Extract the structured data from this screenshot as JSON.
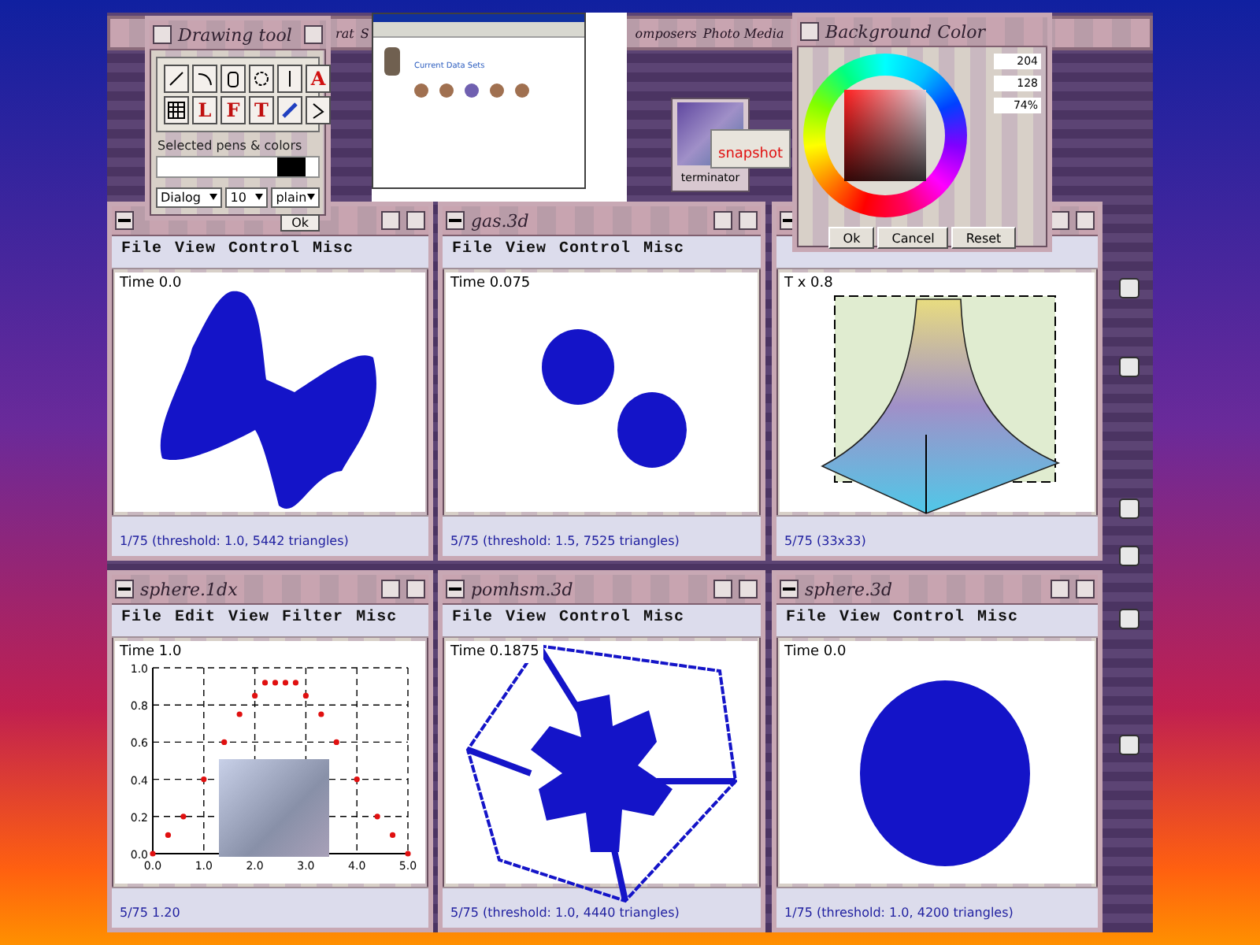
{
  "backdrop": {
    "items": [
      "rat",
      "S",
      "omposers",
      "Photo Media"
    ]
  },
  "drawing_tool": {
    "title": "Drawing tool",
    "tools": [
      {
        "kind": "line"
      },
      {
        "kind": "arc"
      },
      {
        "kind": "cylinder"
      },
      {
        "kind": "circle"
      },
      {
        "kind": "bar"
      },
      {
        "kind": "text_color",
        "glyph": "A"
      },
      {
        "kind": "grid"
      },
      {
        "kind": "letter",
        "glyph": "L"
      },
      {
        "kind": "letter",
        "glyph": "F"
      },
      {
        "kind": "letter",
        "glyph": "T"
      },
      {
        "kind": "pencil"
      },
      {
        "kind": "pointer"
      }
    ],
    "section_label": "Selected pens & colors",
    "dropdowns": [
      "Dialog",
      "10",
      "plain"
    ],
    "ok_button": "Ok"
  },
  "screenshot_window": {
    "heading": "Current Data Sets"
  },
  "desktop_icon": {
    "label": "terminator",
    "tooltip": "snapshot"
  },
  "color_dialog": {
    "title": "Background Color",
    "fields": [
      "204",
      "128",
      "74%"
    ],
    "buttons": [
      "Ok",
      "Cancel",
      "Reset"
    ]
  },
  "windows": [
    {
      "kind": "bowtie",
      "menu": [
        "File",
        "View",
        "Control",
        "Misc"
      ],
      "time_label": "Time 0.0",
      "status": "1/75 (threshold: 1.0, 5442 triangles)"
    },
    {
      "kind": "blobs",
      "title": "gas.3d",
      "menu": [
        "File",
        "View",
        "Control",
        "Misc"
      ],
      "time_label": "Time 0.075",
      "status": "5/75 (threshold: 1.5, 7525 triangles)"
    },
    {
      "kind": "surface",
      "time_label": "T x 0.8",
      "status": "5/75 (33x33)"
    },
    {
      "kind": "plot",
      "title": "sphere.1dx",
      "menu": [
        "File",
        "Edit",
        "View",
        "Filter",
        "Misc"
      ],
      "time_label": "Time 1.0",
      "status": "5/75 1.20",
      "chart_data": {
        "type": "scatter",
        "grid": true,
        "x": [
          0.0,
          0.3,
          0.6,
          1.0,
          1.4,
          1.7,
          2.0,
          2.2,
          2.4,
          2.6,
          2.8,
          3.0,
          3.3,
          3.6,
          4.0,
          4.4,
          4.7,
          5.0
        ],
        "values": [
          0.0,
          0.1,
          0.2,
          0.4,
          0.6,
          0.75,
          0.85,
          0.92,
          0.92,
          0.92,
          0.92,
          0.85,
          0.75,
          0.6,
          0.4,
          0.2,
          0.1,
          0.0
        ],
        "xlim": [
          0,
          5
        ],
        "ylim": [
          0,
          1
        ],
        "xticks": [
          {
            "value": 0,
            "label": "0.0"
          },
          {
            "value": 1,
            "label": "1.0"
          },
          {
            "value": 2,
            "label": "2.0"
          },
          {
            "value": 3,
            "label": "3.0"
          },
          {
            "value": 4,
            "label": "4.0"
          },
          {
            "value": 5,
            "label": "5.0"
          }
        ],
        "yticks": [
          {
            "value": 0,
            "label": "0.0"
          },
          {
            "value": 0.2,
            "label": "0.2"
          },
          {
            "value": 0.4,
            "label": "0.4"
          },
          {
            "value": 0.6,
            "label": "0.6"
          },
          {
            "value": 0.8,
            "label": "0.8"
          },
          {
            "value": 1,
            "label": "1.0"
          }
        ]
      }
    },
    {
      "kind": "star",
      "title": "pomhsm.3d",
      "menu": [
        "File",
        "View",
        "Control",
        "Misc"
      ],
      "time_label": "Time 0.1875",
      "status": "5/75 (threshold: 1.0, 4440 triangles)"
    },
    {
      "kind": "sphere",
      "title": "sphere.3d",
      "menu": [
        "File",
        "View",
        "Control",
        "Misc"
      ],
      "time_label": "Time 0.0",
      "status": "1/75 (threshold: 1.0, 4200 triangles)"
    }
  ]
}
